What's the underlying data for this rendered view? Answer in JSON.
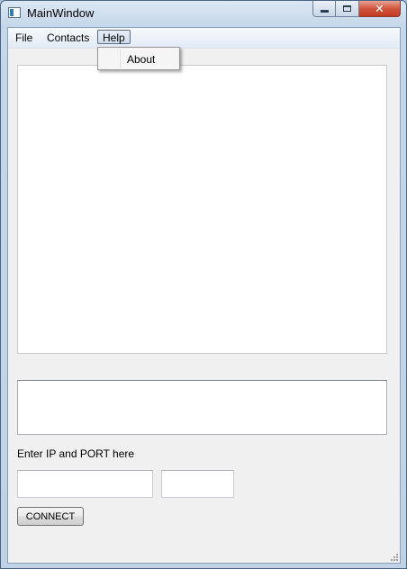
{
  "window": {
    "title": "MainWindow"
  },
  "menu": {
    "file": "File",
    "contacts": "Contacts",
    "help": "Help",
    "help_items": [
      "About"
    ]
  },
  "form": {
    "prompt": "Enter IP and PORT here",
    "ip_value": "",
    "port_value": "",
    "connect_label": "CONNECT"
  },
  "caption_buttons": {
    "close_glyph": "✕"
  }
}
